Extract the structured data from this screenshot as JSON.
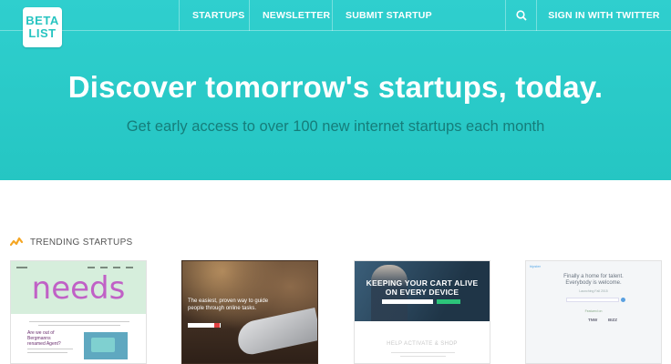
{
  "header": {
    "logo_line1": "BETA",
    "logo_line2": "LIST",
    "nav": {
      "startups": "STARTUPS",
      "newsletter": "NEWSLETTER",
      "submit": "SUBMIT STARTUP",
      "signin": "SIGN IN WITH TWITTER"
    },
    "icons": {
      "startups": "grid-icon",
      "newsletter": "envelope-icon",
      "submit": "edit-icon",
      "search": "search-icon"
    }
  },
  "hero": {
    "title": "Discover tomorrow's startups, today.",
    "subtitle": "Get early access to over 100 new internet startups each month"
  },
  "trending": {
    "label": "TRENDING STARTUPS",
    "icon": "trending-icon",
    "accent_color": "#f5a623"
  },
  "cards": [
    {
      "word": "needs",
      "text": "Are we out of\nBergmanns\nrenamed Agent?"
    },
    {
      "text": "The easiest, proven way to guide\npeople through online tasks."
    },
    {
      "title": "KEEPING YOUR CART ALIVE\nON EVERY DEVICE",
      "footer": "HELP ACTIVATE & SHOP"
    },
    {
      "logo": "hipster",
      "title": "Finally a home for talent.\nEverybody is welcome.",
      "small": "Launching Fall 2015",
      "featured": "Featured on",
      "brands": [
        "",
        "TNW",
        "BIZZ"
      ]
    }
  ],
  "colors": {
    "hero_bg": "#2ccbc9",
    "subtitle": "#157d7a",
    "logo_text": "#27c4c1"
  }
}
